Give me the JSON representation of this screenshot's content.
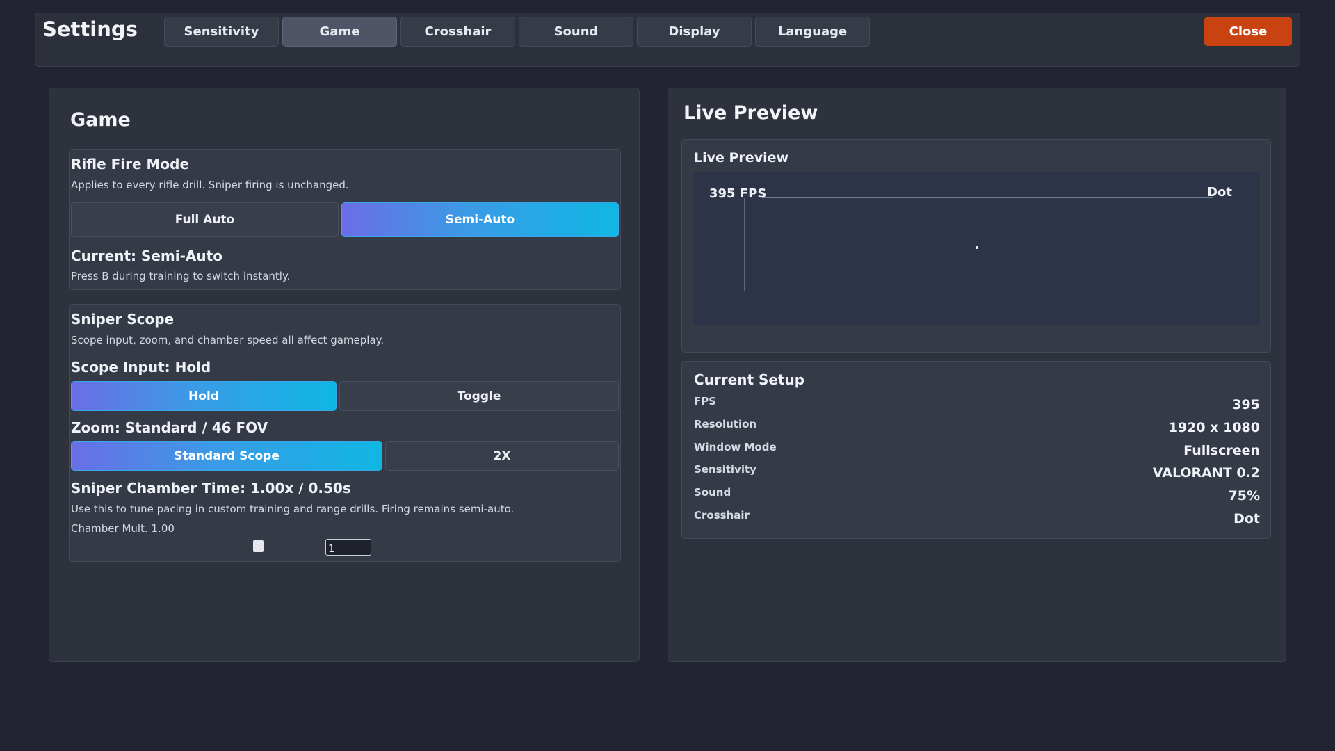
{
  "header": {
    "title": "Settings",
    "tabs": [
      {
        "label": "Sensitivity"
      },
      {
        "label": "Game"
      },
      {
        "label": "Crosshair"
      },
      {
        "label": "Sound"
      },
      {
        "label": "Display"
      },
      {
        "label": "Language"
      }
    ],
    "active_tab": "Game",
    "close_label": "Close"
  },
  "game": {
    "title": "Game",
    "rifle": {
      "title": "Rifle Fire Mode",
      "description": "Applies to every rifle drill. Sniper firing is unchanged.",
      "options": [
        "Full Auto",
        "Semi-Auto"
      ],
      "selected": "Semi-Auto",
      "current": "Current: Semi-Auto",
      "hint": "Press B during training to switch instantly."
    },
    "sniper": {
      "title": "Sniper Scope",
      "description": "Scope input, zoom, and chamber speed all affect gameplay.",
      "scope_input_label": "Scope Input: Hold",
      "scope_input_options": [
        "Hold",
        "Toggle"
      ],
      "scope_input_selected": "Hold",
      "zoom_label": "Zoom: Standard / 46 FOV",
      "zoom_options": [
        "Standard Scope",
        "2X"
      ],
      "zoom_selected": "Standard Scope",
      "chamber_label": "Sniper Chamber Time: 1.00x / 0.50s",
      "chamber_hint": "Use this to tune pacing in custom training and range drills. Firing remains semi-auto.",
      "chamber_mult_label": "Chamber Mult. 1.00",
      "chamber_mult_value": "1"
    }
  },
  "preview": {
    "title": "Live Preview",
    "card_title": "Live Preview",
    "fps_label": "395 FPS",
    "crosshair_label": "Dot"
  },
  "setup": {
    "title": "Current Setup",
    "rows": [
      {
        "key": "FPS",
        "value": "395"
      },
      {
        "key": "Resolution",
        "value": "1920 x 1080"
      },
      {
        "key": "Window Mode",
        "value": "Fullscreen"
      },
      {
        "key": "Sensitivity",
        "value": "VALORANT 0.2"
      },
      {
        "key": "Sound",
        "value": "75%"
      },
      {
        "key": "Crosshair",
        "value": "Dot"
      }
    ]
  },
  "colors": {
    "background": "#222531",
    "accent_gradient_start": "#6a6ee6",
    "accent_gradient_end": "#0fb7e3",
    "close_button": "#c84311"
  }
}
